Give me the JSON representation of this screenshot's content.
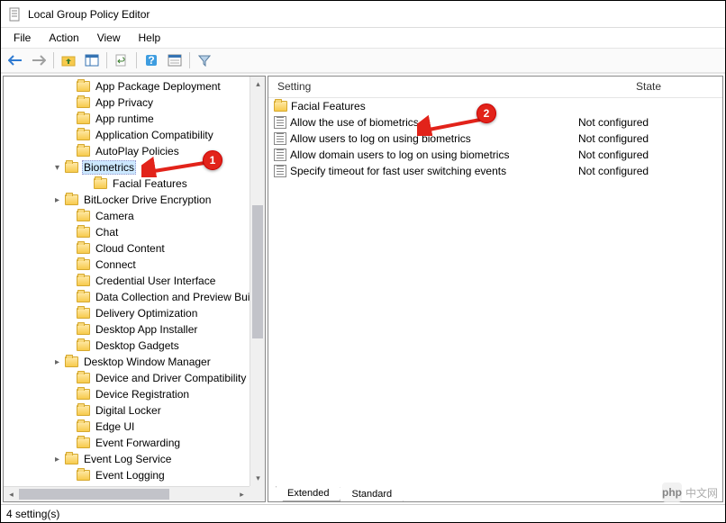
{
  "window": {
    "title": "Local Group Policy Editor"
  },
  "menu": {
    "file": "File",
    "action": "Action",
    "view": "View",
    "help": "Help"
  },
  "tree": {
    "items": [
      {
        "label": "App Package Deployment",
        "indent": 66,
        "expander": ""
      },
      {
        "label": "App Privacy",
        "indent": 66,
        "expander": ""
      },
      {
        "label": "App runtime",
        "indent": 66,
        "expander": ""
      },
      {
        "label": "Application Compatibility",
        "indent": 66,
        "expander": ""
      },
      {
        "label": "AutoPlay Policies",
        "indent": 66,
        "expander": ""
      },
      {
        "label": "Biometrics",
        "indent": 53,
        "expander": "▾",
        "selected": true
      },
      {
        "label": "Facial Features",
        "indent": 85,
        "expander": ""
      },
      {
        "label": "BitLocker Drive Encryption",
        "indent": 53,
        "expander": "▸"
      },
      {
        "label": "Camera",
        "indent": 66,
        "expander": ""
      },
      {
        "label": "Chat",
        "indent": 66,
        "expander": ""
      },
      {
        "label": "Cloud Content",
        "indent": 66,
        "expander": ""
      },
      {
        "label": "Connect",
        "indent": 66,
        "expander": ""
      },
      {
        "label": "Credential User Interface",
        "indent": 66,
        "expander": ""
      },
      {
        "label": "Data Collection and Preview Buil",
        "indent": 66,
        "expander": ""
      },
      {
        "label": "Delivery Optimization",
        "indent": 66,
        "expander": ""
      },
      {
        "label": "Desktop App Installer",
        "indent": 66,
        "expander": ""
      },
      {
        "label": "Desktop Gadgets",
        "indent": 66,
        "expander": ""
      },
      {
        "label": "Desktop Window Manager",
        "indent": 53,
        "expander": "▸"
      },
      {
        "label": "Device and Driver Compatibility",
        "indent": 66,
        "expander": ""
      },
      {
        "label": "Device Registration",
        "indent": 66,
        "expander": ""
      },
      {
        "label": "Digital Locker",
        "indent": 66,
        "expander": ""
      },
      {
        "label": "Edge UI",
        "indent": 66,
        "expander": ""
      },
      {
        "label": "Event Forwarding",
        "indent": 66,
        "expander": ""
      },
      {
        "label": "Event Log Service",
        "indent": 53,
        "expander": "▸"
      },
      {
        "label": "Event Logging",
        "indent": 66,
        "expander": ""
      }
    ]
  },
  "list": {
    "header": {
      "setting": "Setting",
      "state": "State"
    },
    "rows": [
      {
        "type": "folder",
        "setting": "Facial Features",
        "state": ""
      },
      {
        "type": "policy",
        "setting": "Allow the use of biometrics",
        "state": "Not configured"
      },
      {
        "type": "policy",
        "setting": "Allow users to log on using biometrics",
        "state": "Not configured"
      },
      {
        "type": "policy",
        "setting": "Allow domain users to log on using biometrics",
        "state": "Not configured"
      },
      {
        "type": "policy",
        "setting": "Specify timeout for fast user switching events",
        "state": "Not configured"
      }
    ]
  },
  "tabs": {
    "extended": "Extended",
    "standard": "Standard"
  },
  "status": {
    "text": "4 setting(s)"
  },
  "annotations": {
    "badge1": "1",
    "badge2": "2"
  },
  "watermark": {
    "logo": "php",
    "text": "中文网"
  }
}
